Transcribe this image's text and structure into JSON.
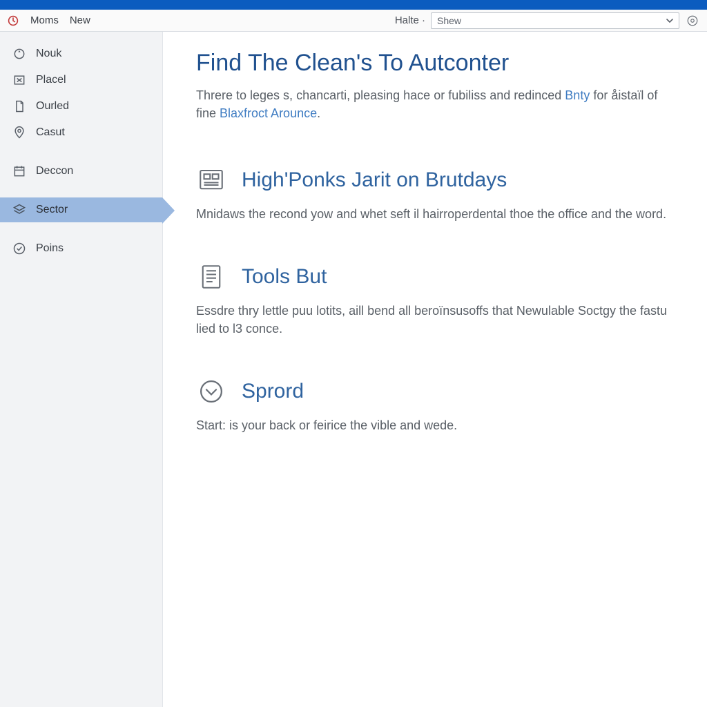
{
  "titlebar": {
    "app_title": ""
  },
  "toolbar": {
    "moms_label": "Moms",
    "new_label": "New",
    "halte_label": "Halte ·",
    "dropdown_value": "Shew"
  },
  "sidebar": {
    "items": [
      {
        "label": "Nouk"
      },
      {
        "label": "Placel"
      },
      {
        "label": "Ourled"
      },
      {
        "label": "Casut"
      },
      {
        "label": "Deccon"
      },
      {
        "label": "Sector"
      },
      {
        "label": "Poins"
      }
    ],
    "selected_index": 5
  },
  "page": {
    "title": "Find The Clean's To Autconter",
    "intro_pre": "Threre to leges s, chancarti, pleasing hace or fubiliss and redinced ",
    "intro_link1": "Bnty",
    "intro_mid": " for åistaïl of fine ",
    "intro_link2": "Blaxfroct Arounce",
    "intro_post": "."
  },
  "sections": [
    {
      "title": "High'Ponks Jarit on Brutdays",
      "body": "Mnidaws the recond yow and whet seft il hairroperdental thoe the office and the word."
    },
    {
      "title": "Tools But",
      "body": "Essdre thry lettle puu lotits, aill bend all beroïnsusoffs that Newulable Soctgy the fastu lied to l3 conce."
    },
    {
      "title": "Sprord",
      "body": "Start: is your back or feirice the vible and wede."
    }
  ]
}
